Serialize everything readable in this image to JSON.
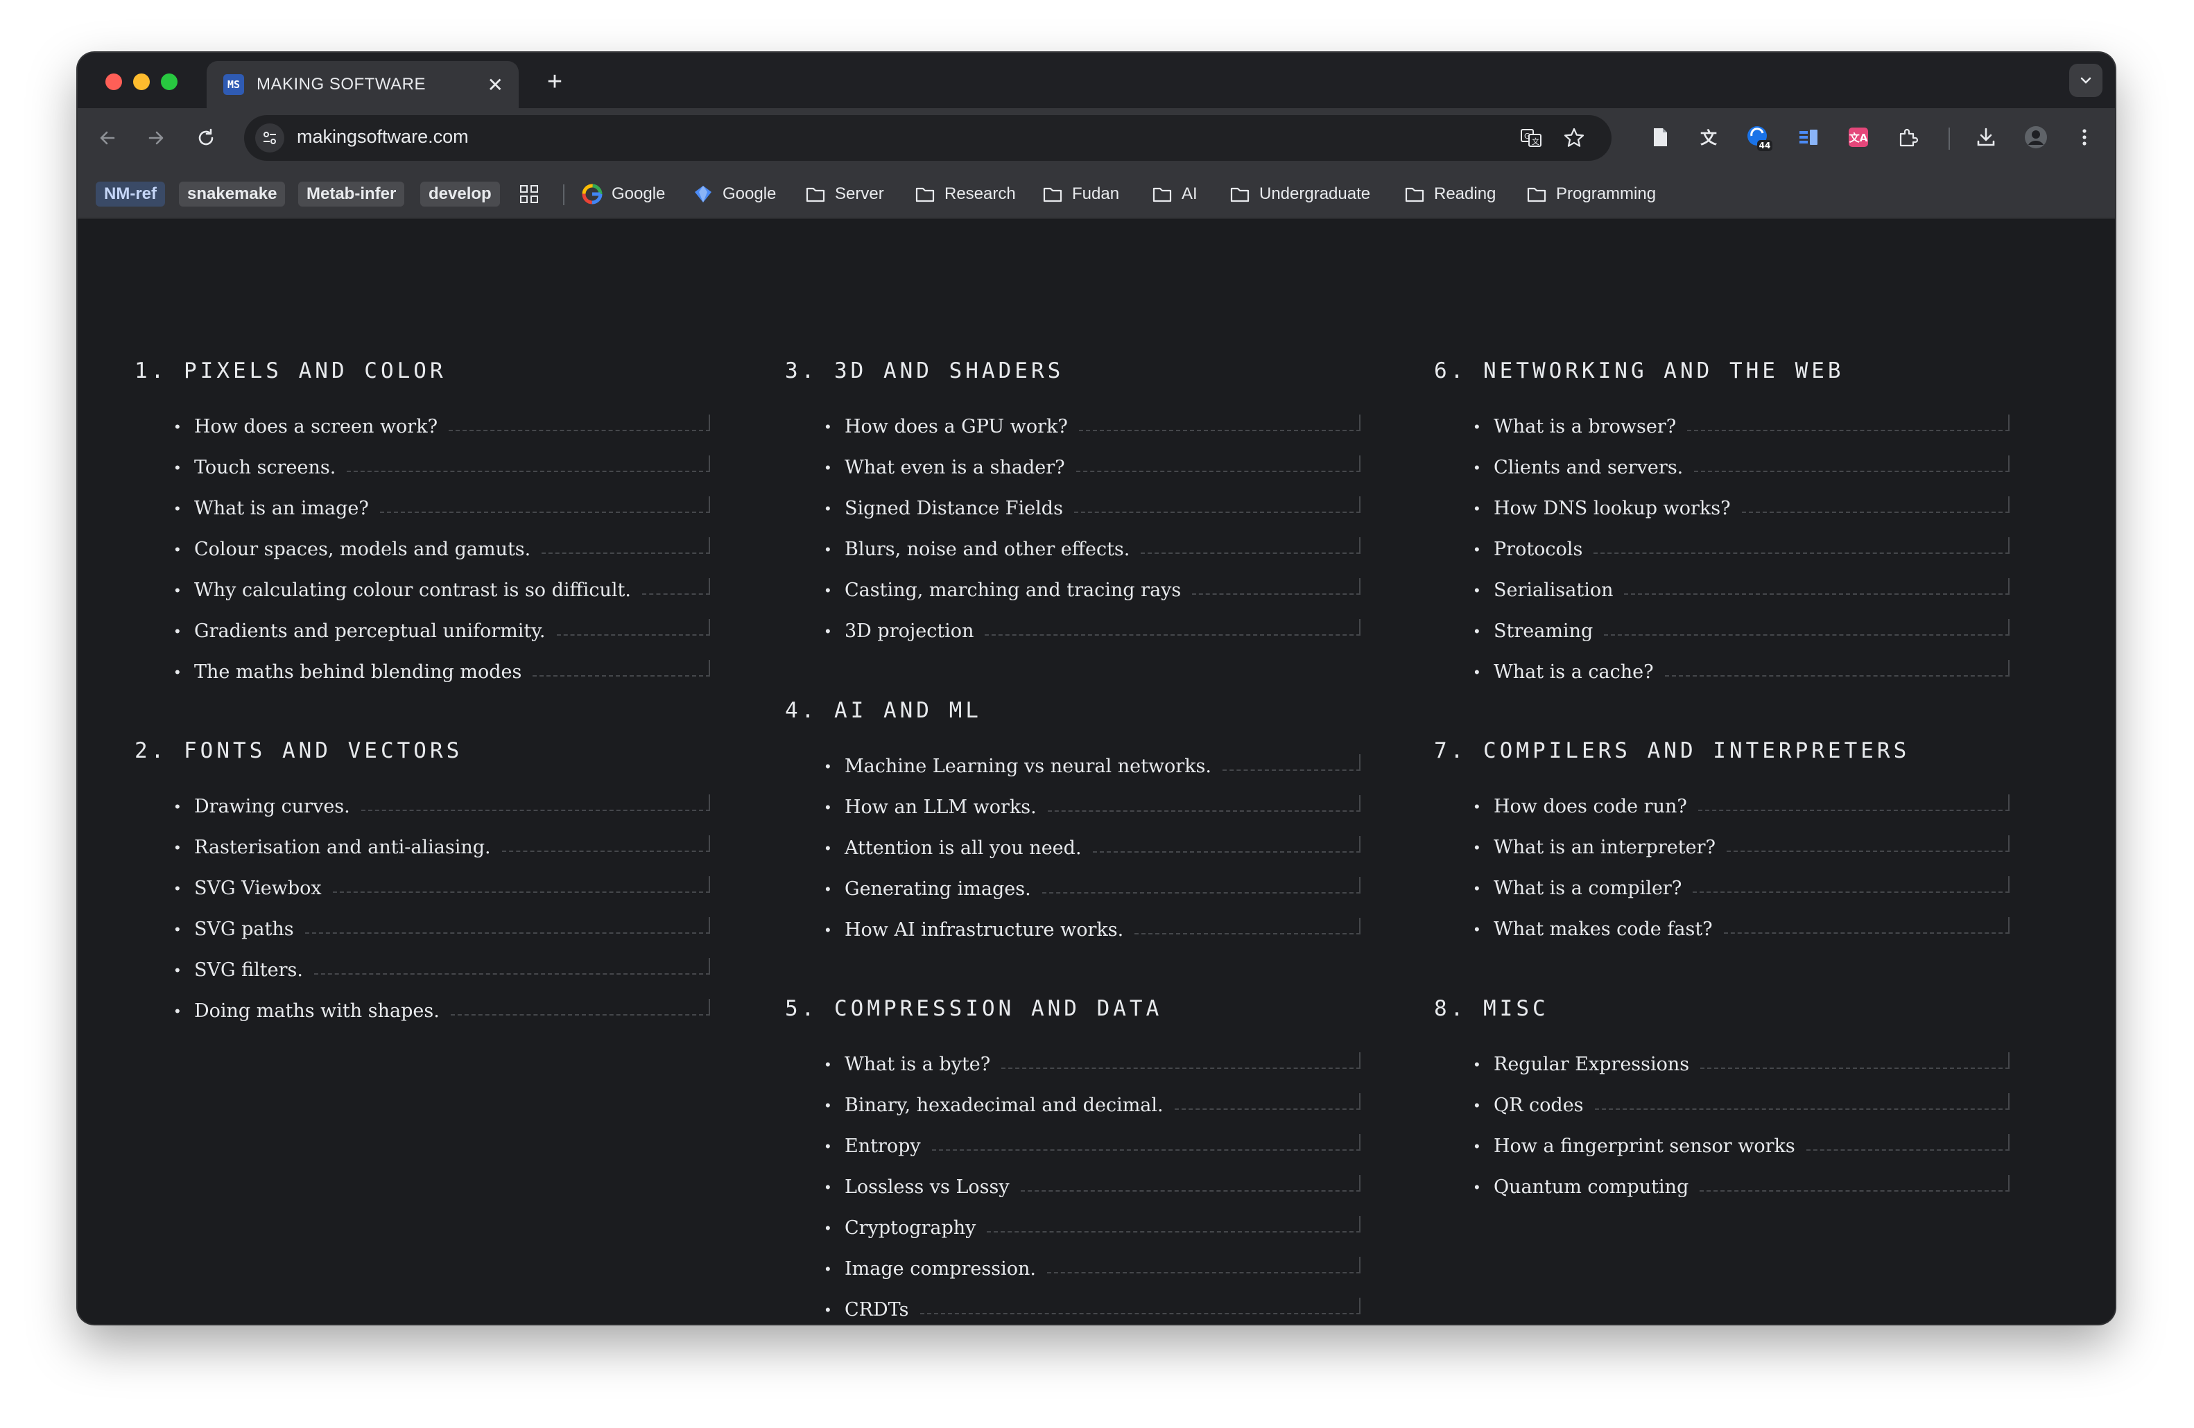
{
  "browser": {
    "tab_favicon_text": "MS",
    "tab_title": "MAKING SOFTWARE",
    "tab_close": "✕",
    "new_tab": "+",
    "url": "makingsoftware.com",
    "extension_badge": "44"
  },
  "bookmarks": {
    "chips": [
      "NM-ref",
      "snakemake",
      "Metab-infer",
      "develop"
    ],
    "links": [
      "Google",
      "Google"
    ],
    "folders": [
      "Server",
      "Research",
      "Fudan",
      "AI",
      "Undergraduate",
      "Reading",
      "Programming"
    ]
  },
  "sections": [
    {
      "title": "1. PIXELS AND COLOR",
      "items": [
        "How does a screen work?",
        "Touch screens.",
        "What is an image?",
        "Colour spaces, models and gamuts.",
        "Why calculating colour contrast is so difficult.",
        "Gradients and perceptual uniformity.",
        "The maths behind blending modes"
      ]
    },
    {
      "title": "2. FONTS AND VECTORS",
      "items": [
        "Drawing curves.",
        "Rasterisation and anti-aliasing.",
        "SVG Viewbox",
        "SVG paths",
        "SVG filters.",
        "Doing maths with shapes."
      ]
    },
    {
      "title": "3. 3D AND SHADERS",
      "items": [
        "How does a GPU work?",
        "What even is a shader?",
        "Signed Distance Fields",
        "Blurs, noise and other effects.",
        "Casting, marching and tracing rays",
        "3D projection"
      ]
    },
    {
      "title": "4. AI AND ML",
      "items": [
        "Machine Learning vs neural networks.",
        "How an LLM works.",
        "Attention is all you need.",
        "Generating images.",
        "How AI infrastructure works."
      ]
    },
    {
      "title": "5. COMPRESSION AND DATA",
      "items": [
        "What is a byte?",
        "Binary, hexadecimal and decimal.",
        "Entropy",
        "Lossless vs Lossy",
        "Cryptography",
        "Image compression.",
        "CRDTs"
      ]
    },
    {
      "title": "6. NETWORKING AND THE WEB",
      "items": [
        "What is a browser?",
        "Clients and servers.",
        "How DNS lookup works?",
        "Protocols",
        "Serialisation",
        "Streaming",
        "What is a cache?"
      ]
    },
    {
      "title": "7. COMPILERS AND INTERPRETERS",
      "items": [
        "How does code run?",
        "What is an interpreter?",
        "What is a compiler?",
        "What makes code fast?"
      ]
    },
    {
      "title": "8. MISC",
      "items": [
        "Regular Expressions",
        "QR codes",
        "How a fingerprint sensor works",
        "Quantum computing"
      ]
    }
  ]
}
